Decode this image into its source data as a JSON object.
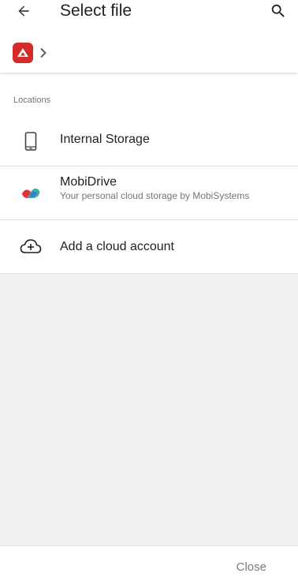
{
  "appbar": {
    "title": "Select file",
    "back_icon": "arrow-left-icon",
    "search_icon": "search-icon"
  },
  "breadcrumb": {
    "root_icon": "office-suite-logo-icon",
    "separator_icon": "chevron-right-icon"
  },
  "locations": {
    "section_label": "Locations",
    "items": [
      {
        "label": "Internal Storage",
        "sublabel": "",
        "icon": "phone-icon"
      },
      {
        "label": "MobiDrive",
        "sublabel": "Your personal cloud storage by MobiSystems",
        "icon": "mobidrive-icon"
      },
      {
        "label": "Add a cloud account",
        "sublabel": "",
        "icon": "cloud-add-icon"
      }
    ]
  },
  "footer": {
    "close_label": "Close"
  },
  "colors": {
    "brand_red": "#d32a2a",
    "mobidrive_teal": "#34b3a0",
    "mobidrive_blue": "#3a7bd5",
    "mobidrive_red": "#e0333a",
    "background_gray": "#f0f0f0"
  }
}
